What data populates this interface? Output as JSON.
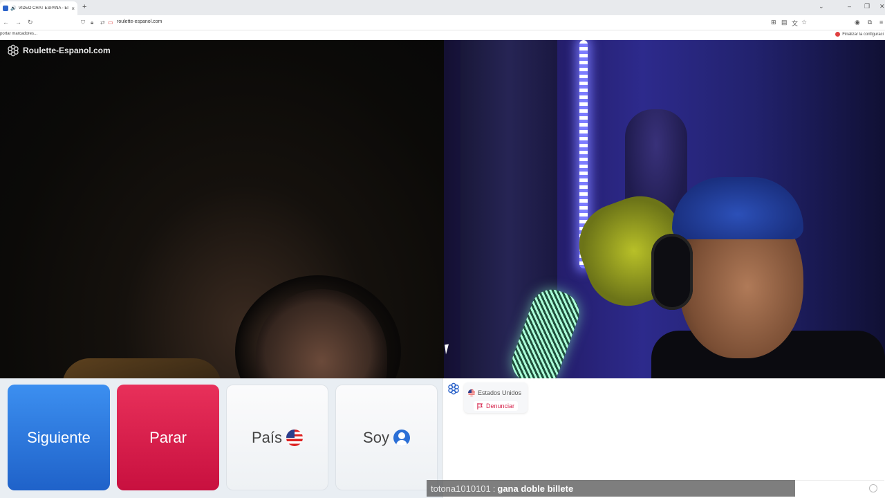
{
  "browser": {
    "tab_title": "VIDEO CHAT ESPAÑA - El ch",
    "tab_close": "×",
    "new_tab": "+",
    "url": "roulette-espanol.com",
    "bookmarks_left": "portar marcadores...",
    "bookmarks_right": "Finalizar la configuraci",
    "icons": [
      "back-icon",
      "forward-icon",
      "reload-icon",
      "shield-icon",
      "lock-icon",
      "permissions-icon",
      "camera-icon",
      "save-page-icon",
      "reader-icon",
      "translate-icon",
      "star-icon",
      "account-icon",
      "extensions-icon",
      "menu-icon"
    ]
  },
  "site": {
    "logo_text": "Roulette-Espanol.com"
  },
  "controls": {
    "next_label": "Siguiente",
    "stop_label": "Parar",
    "country_label": "País",
    "soy_label": "Soy",
    "colors": {
      "next": "#2a76e0",
      "stop": "#d91d4b"
    }
  },
  "chat": {
    "partner_country": "Estados Unidos",
    "report_label": "Denunciar"
  },
  "overlay": {
    "username": "totona1010101",
    "separator": ":",
    "message": "gana doble billete"
  }
}
